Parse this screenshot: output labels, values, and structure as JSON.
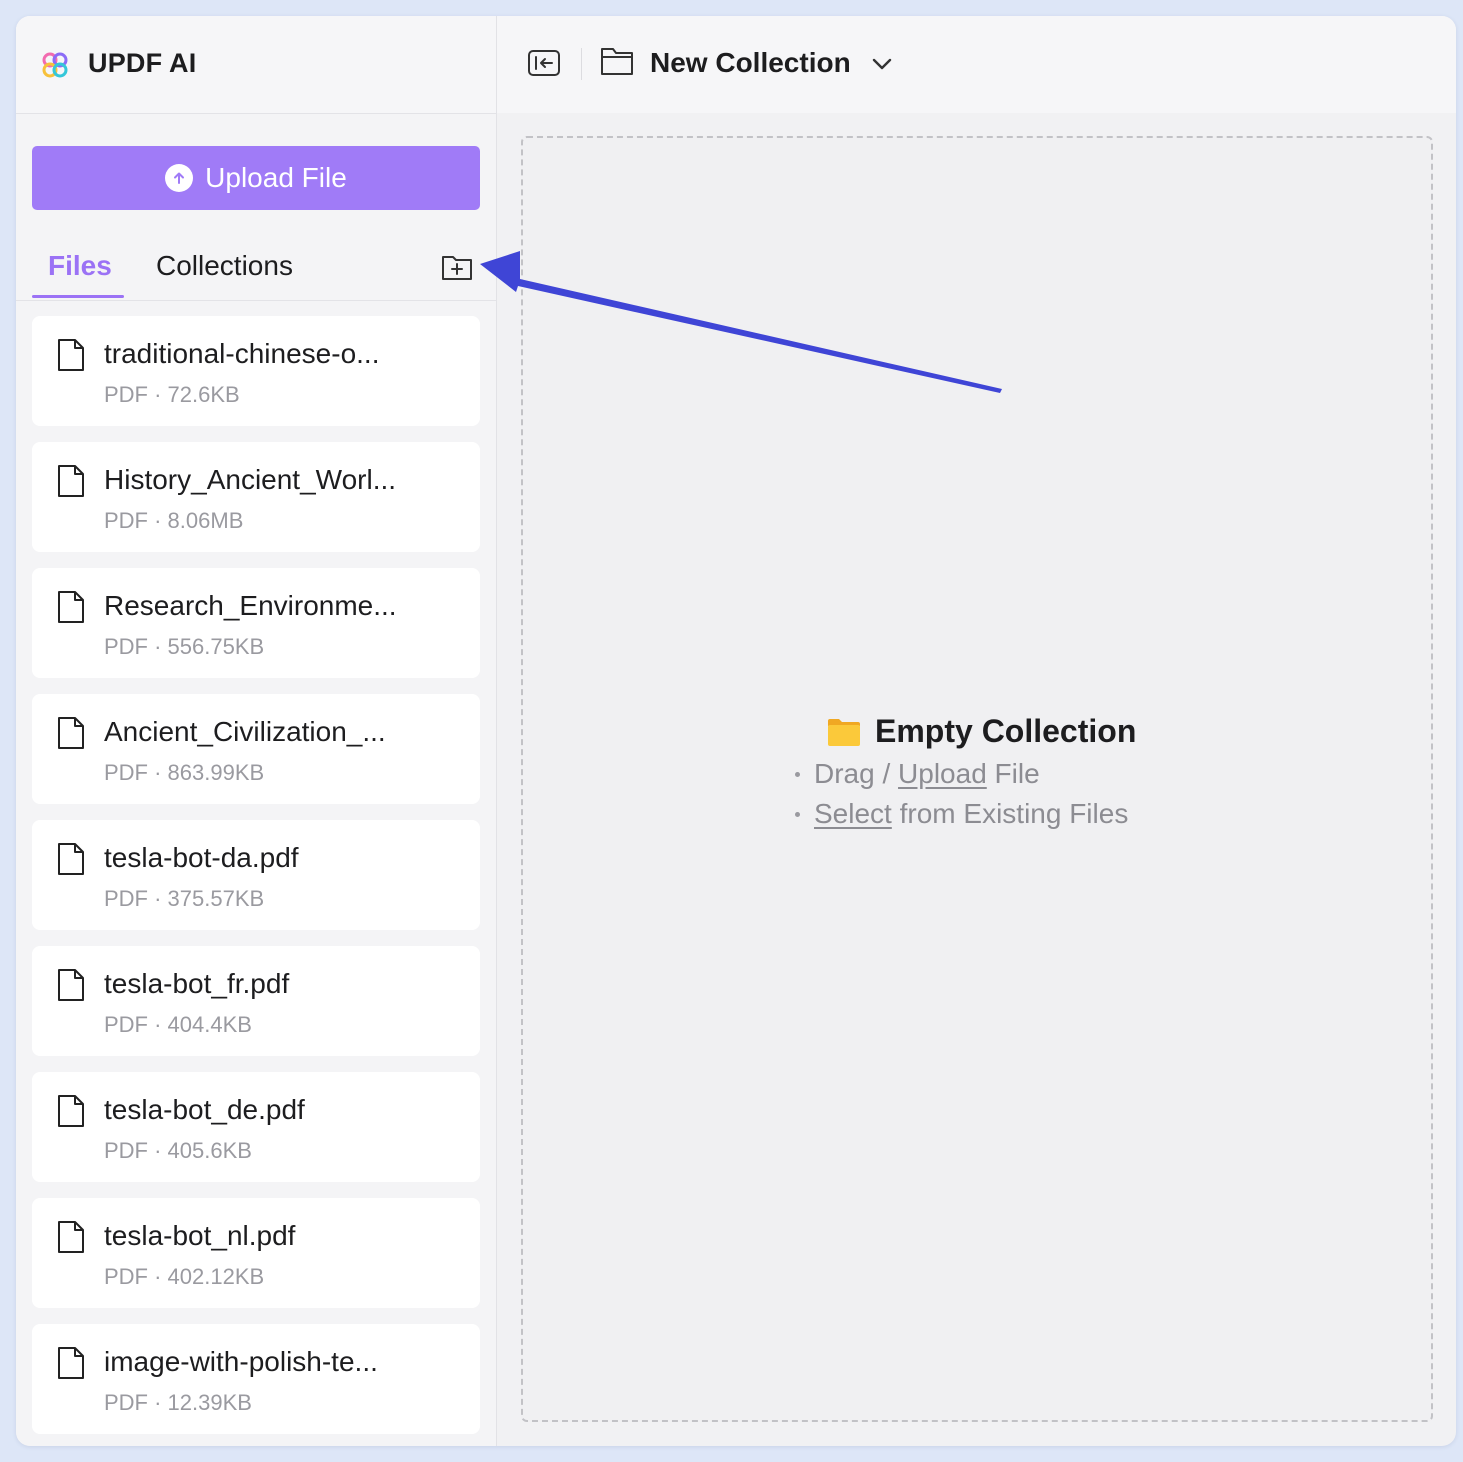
{
  "app": {
    "title": "UPDF AI"
  },
  "sidebar": {
    "upload_label": "Upload File",
    "tabs": [
      {
        "label": "Files",
        "active": true
      },
      {
        "label": "Collections",
        "active": false
      }
    ],
    "files": [
      {
        "name": "traditional-chinese-o...",
        "meta": "PDF · 72.6KB"
      },
      {
        "name": "History_Ancient_Worl...",
        "meta": "PDF · 8.06MB"
      },
      {
        "name": "Research_Environme...",
        "meta": "PDF · 556.75KB"
      },
      {
        "name": "Ancient_Civilization_...",
        "meta": "PDF · 863.99KB"
      },
      {
        "name": "tesla-bot-da.pdf",
        "meta": "PDF · 375.57KB"
      },
      {
        "name": "tesla-bot_fr.pdf",
        "meta": "PDF · 404.4KB"
      },
      {
        "name": "tesla-bot_de.pdf",
        "meta": "PDF · 405.6KB"
      },
      {
        "name": "tesla-bot_nl.pdf",
        "meta": "PDF · 402.12KB"
      },
      {
        "name": "image-with-polish-te...",
        "meta": "PDF · 12.39KB"
      }
    ]
  },
  "main": {
    "collection_title": "New Collection",
    "empty": {
      "title": "Empty Collection",
      "hint1_prefix": "Drag / ",
      "hint1_link": "Upload",
      "hint1_suffix": " File",
      "hint2_link": "Select",
      "hint2_suffix": " from Existing Files"
    }
  },
  "colors": {
    "accent": "#9b72f5",
    "upload_button": "#a07bf7",
    "arrow_annotation": "#3f45d6",
    "folder_yellow": "#f9c636"
  }
}
